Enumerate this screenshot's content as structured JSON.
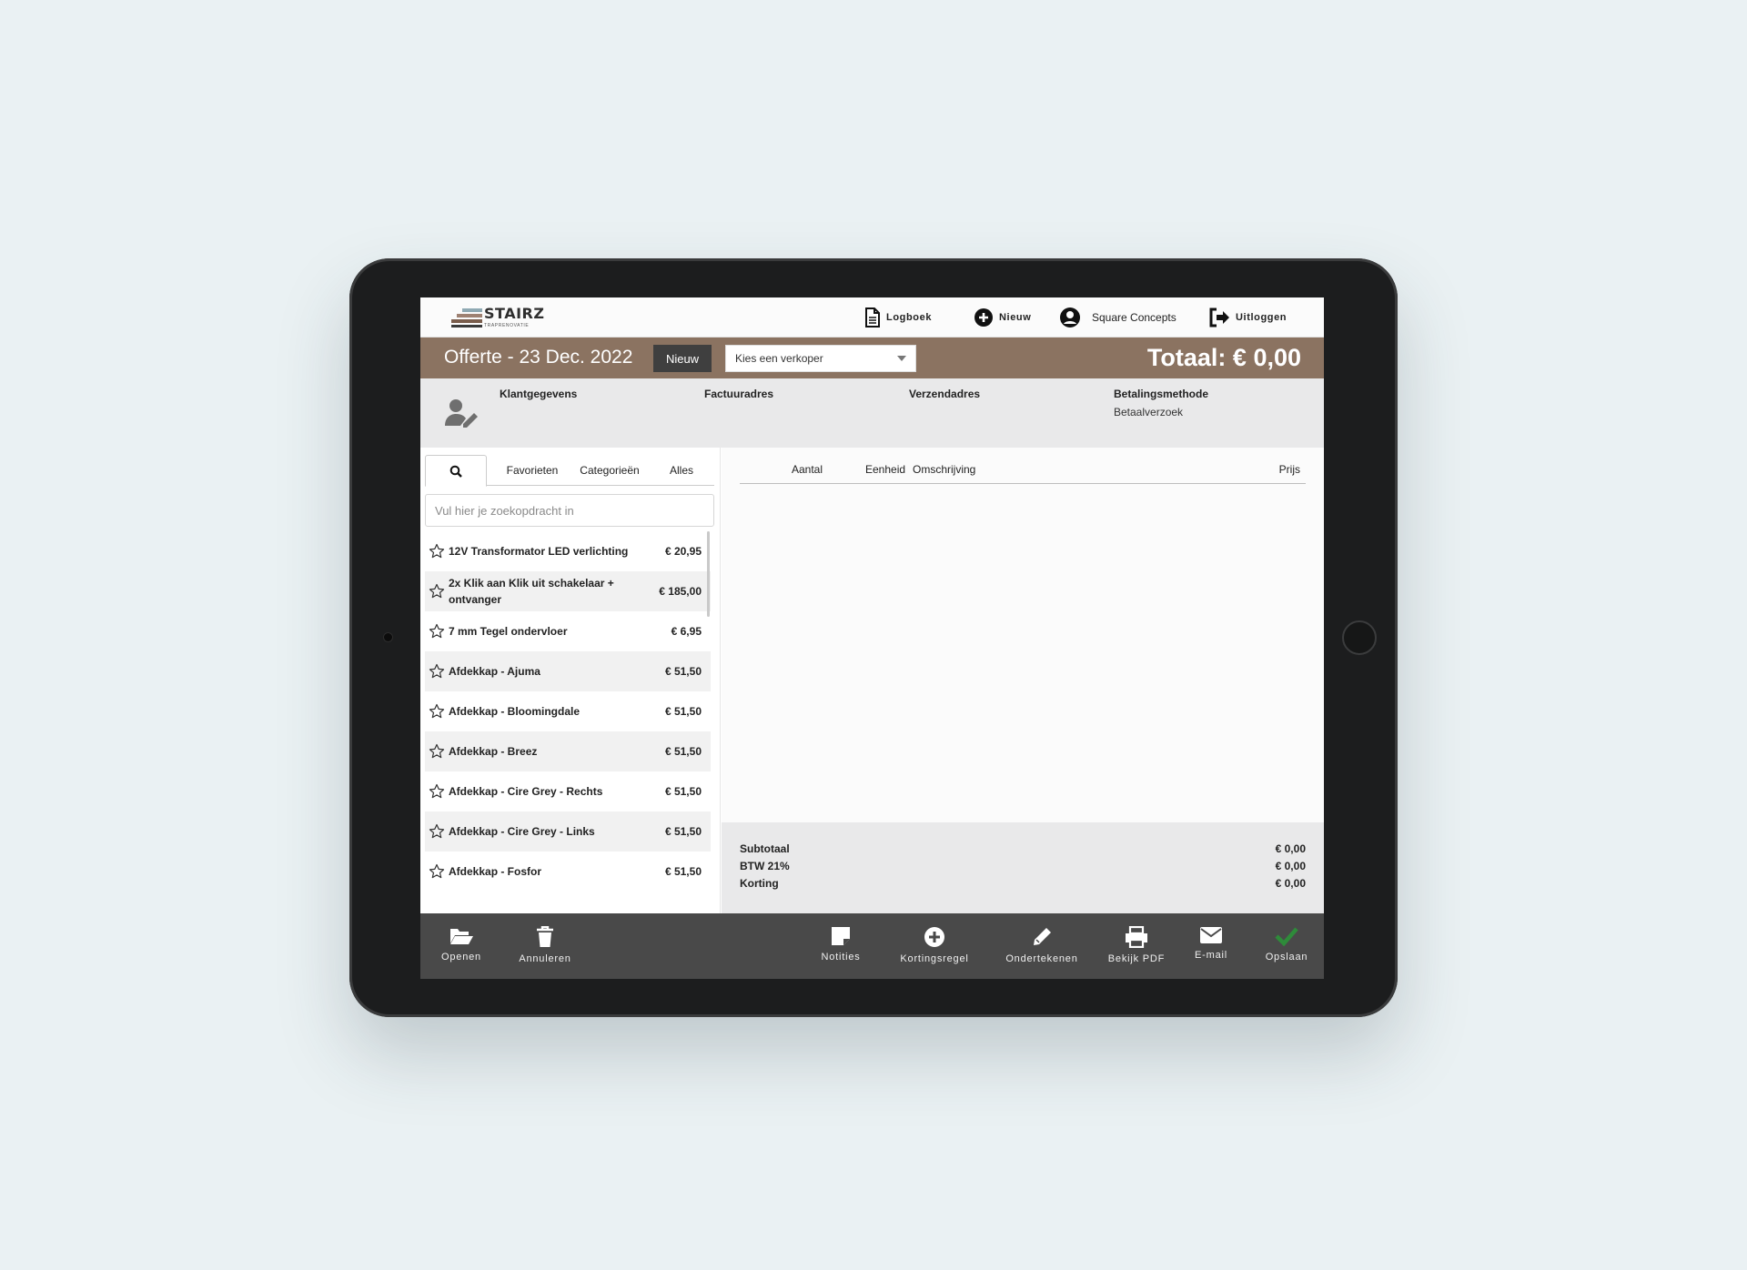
{
  "header": {
    "logo_name": "STAIRZ",
    "logo_sub": "TRAPRENOVATIE",
    "nav": {
      "logboek": "Logboek",
      "nieuw": "Nieuw",
      "user": "Square Concepts",
      "uitloggen": "Uitloggen"
    }
  },
  "titlebar": {
    "title": "Offerte - 23 Dec. 2022",
    "new_button": "Nieuw",
    "seller_select": "Kies een verkoper",
    "total": "Totaal: € 0,00"
  },
  "info": {
    "klant": "Klantgegevens",
    "factuur": "Factuuradres",
    "verzend": "Verzendadres",
    "betaling": "Betalingsmethode",
    "betaling_value": "Betaalverzoek"
  },
  "products": {
    "tabs": [
      "Favorieten",
      "Categorieën",
      "Alles"
    ],
    "search_placeholder": "Vul hier je zoekopdracht in",
    "items": [
      {
        "name": "12V Transformator LED verlichting",
        "price": "€ 20,95"
      },
      {
        "name": "2x Klik aan Klik uit schakelaar + ontvanger",
        "price": "€ 185,00"
      },
      {
        "name": "7 mm Tegel ondervloer",
        "price": "€ 6,95"
      },
      {
        "name": "Afdekkap - Ajuma",
        "price": "€ 51,50"
      },
      {
        "name": "Afdekkap - Bloomingdale",
        "price": "€ 51,50"
      },
      {
        "name": "Afdekkap - Breez",
        "price": "€ 51,50"
      },
      {
        "name": "Afdekkap - Cire Grey - Rechts",
        "price": "€ 51,50"
      },
      {
        "name": "Afdekkap - Cire Grey - Links",
        "price": "€ 51,50"
      },
      {
        "name": "Afdekkap - Fosfor",
        "price": "€ 51,50"
      }
    ]
  },
  "order": {
    "columns": {
      "aantal": "Aantal",
      "eenheid": "Eenheid",
      "omschrijving": "Omschrijving",
      "prijs": "Prijs"
    },
    "subtotal_label": "Subtotaal",
    "subtotal": "€ 0,00",
    "btw_label": "BTW 21%",
    "btw": "€ 0,00",
    "korting_label": "Korting",
    "korting": "€ 0,00"
  },
  "toolbar": {
    "openen": "Openen",
    "annuleren": "Annuleren",
    "notities": "Notities",
    "kortingsregel": "Kortingsregel",
    "ondertekenen": "Ondertekenen",
    "bekijk_pdf": "Bekijk PDF",
    "email": "E-mail",
    "opslaan": "Opslaan"
  },
  "colors": {
    "brand_brown": "#8b7361",
    "toolbar": "#494949",
    "save_check": "#2e8b3a"
  }
}
